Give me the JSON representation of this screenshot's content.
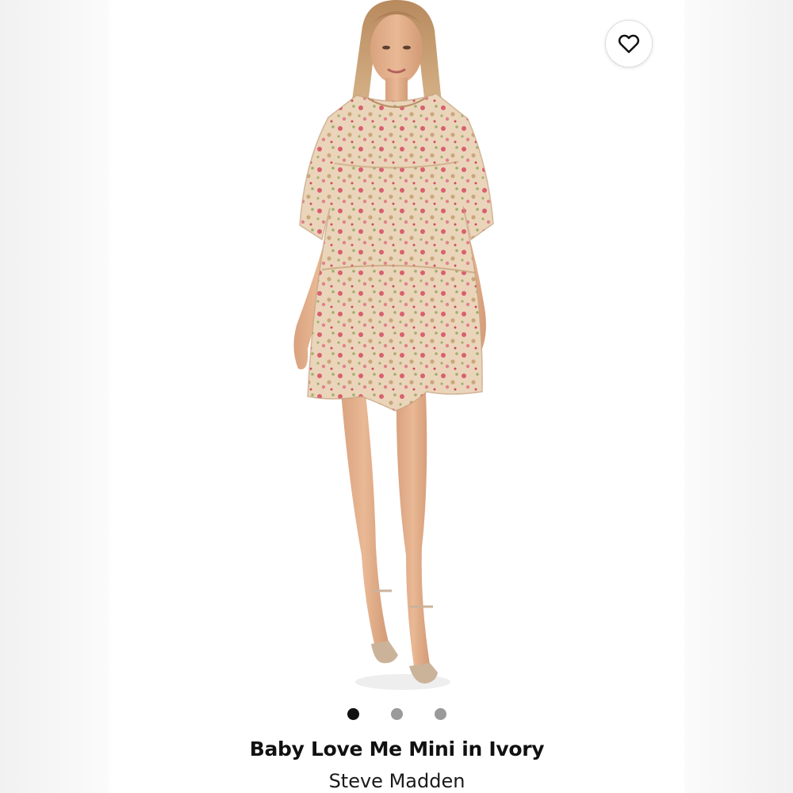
{
  "product": {
    "title": "Baby Love Me Mini in Ivory",
    "brand": "Steve Madden"
  },
  "carousel": {
    "total": 3,
    "active_index": 0
  },
  "icons": {
    "favorite": "heart-outline-icon"
  },
  "colors": {
    "dot_active": "#111111",
    "dot_inactive": "#9a9a9a",
    "dress_base": "#e9d3b8",
    "dress_floral": "#d4606f"
  }
}
